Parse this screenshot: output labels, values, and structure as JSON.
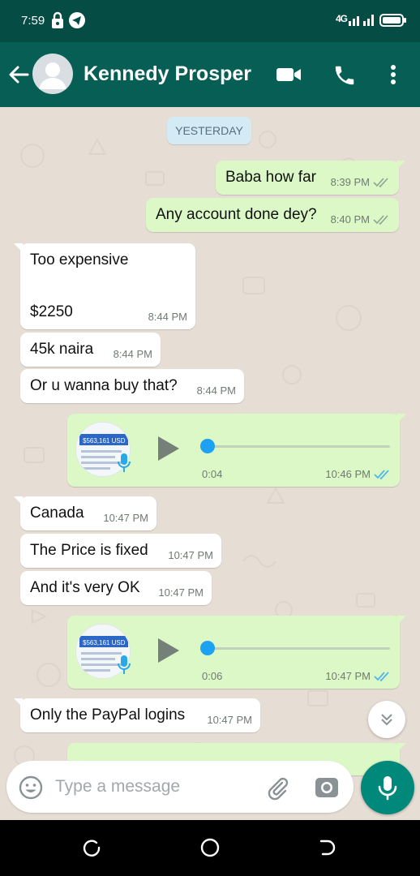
{
  "status_bar": {
    "time": "7:59",
    "network": "4G"
  },
  "header": {
    "contact_name": "Kennedy Prosper",
    "icons": [
      "back-arrow-icon",
      "avatar",
      "video-call-icon",
      "voice-call-icon",
      "more-options-icon"
    ]
  },
  "chat": {
    "date_label": "YESTERDAY",
    "messages": [
      {
        "dir": "out",
        "text": "Baba how far",
        "time": "8:39 PM",
        "ticks": "double-gray"
      },
      {
        "dir": "out",
        "text": "Any account done dey?",
        "time": "8:40 PM",
        "ticks": "double-gray"
      },
      {
        "dir": "in",
        "text_line1": "Too expensive",
        "text_line2": "$2250",
        "time": "8:44 PM"
      },
      {
        "dir": "in",
        "text": "45k naira",
        "time": "8:44 PM"
      },
      {
        "dir": "in",
        "text": "Or u wanna buy that?",
        "time": "8:44 PM"
      },
      {
        "dir": "out",
        "type": "voice",
        "duration": "0:04",
        "time": "10:46 PM",
        "ticks": "double-blue",
        "progress": 0
      },
      {
        "dir": "in",
        "text": "Canada",
        "time": "10:47 PM"
      },
      {
        "dir": "in",
        "text": "The Price is fixed",
        "time": "10:47 PM"
      },
      {
        "dir": "in",
        "text": "And it's very OK",
        "time": "10:47 PM"
      },
      {
        "dir": "out",
        "type": "voice",
        "duration": "0:06",
        "time": "10:47 PM",
        "ticks": "double-blue",
        "progress": 0
      },
      {
        "dir": "in",
        "text": "Only the PayPal logins",
        "time": "10:47 PM"
      }
    ],
    "thumb_text": "$563,161 USD"
  },
  "composer": {
    "placeholder": "Type a message"
  },
  "colors": {
    "header": "#075e54",
    "status_bar": "#054d44",
    "outgoing_bubble": "#dcf8c6",
    "incoming_bubble": "#ffffff",
    "chat_bg": "#e6ddd4",
    "read_ticks": "#4fb6ec",
    "fab": "#00897b"
  }
}
